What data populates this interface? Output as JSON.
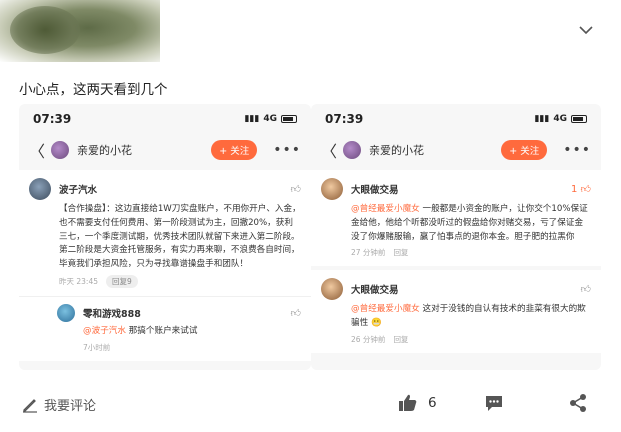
{
  "post": {
    "text": "小心点，这两天看到几个"
  },
  "left_screen": {
    "time": "07:39",
    "network": "4G",
    "nav_name": "亲爱的小花",
    "follow": "+ 关注",
    "comment": {
      "author": "波子汽水",
      "body": "【合作操盘】：这边直接给1W刀实盘账户，不用你开户、入金，也不需要支付任何费用、第一阶段测试为主，回撤20%，获利三七，一个季度测试期，优秀技术团队就留下来进入第二阶段。第二阶段是大资金托管服务，有实力再来聊，不浪费各自时间，毕竟我们承担风险，只为寻找靠谱操盘手和团队！",
      "time": "昨天 23:45",
      "reply_count": "回复9"
    },
    "reply": {
      "author": "零和游戏888",
      "mention": "@波子汽水",
      "body": " 那搞个账户来试试",
      "time": "7小时前"
    }
  },
  "right_screen": {
    "time": "07:39",
    "network": "4G",
    "nav_name": "亲爱的小花",
    "follow": "+ 关注",
    "comment1": {
      "author": "大眼做交易",
      "likes": "1",
      "mention": "@曾经最爱小魔女",
      "body": " 一般都是小资金的账户，让你交个10%保证金给他，他给个听都没听过的假盘给你对赌交易，亏了保证金没了你爆赌服输，赢了怕事点的退你本金。胆子肥的拉黑你",
      "time": "27 分钟前",
      "reply": "回复"
    },
    "comment2": {
      "author": "大眼做交易",
      "mention": "@曾经最爱小魔女",
      "body": " 这对于没钱的自认有技术的韭菜有很大的欺骗性",
      "time": "26 分钟前",
      "reply": "回复"
    }
  },
  "bottom_bar": {
    "comment_placeholder": "我要评论",
    "like_count": "6"
  }
}
